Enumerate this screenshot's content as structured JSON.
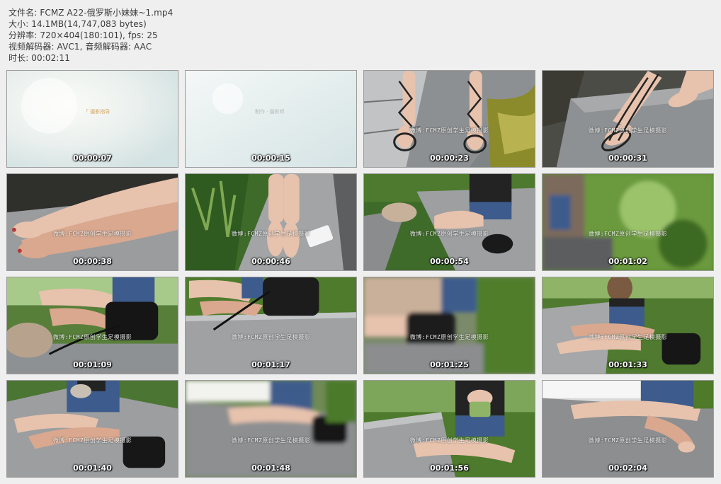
{
  "header": {
    "filename": "文件名: FCMZ A22-俄罗斯小妹妹~1.mp4",
    "size": "大小: 14.1MB(14,747,083 bytes)",
    "resolution": "分辨率: 720×404(180:101), fps: 25",
    "codecs": "视频解码器: AVC1, 音频解码器: AAC",
    "duration": "时长: 00:02:11"
  },
  "thumbnails": [
    {
      "time": "00:00:07",
      "scene": "intro-1",
      "caption": "「 摄影指导",
      "watermark": ""
    },
    {
      "time": "00:00:15",
      "scene": "intro-2",
      "caption": "制作 · 摄影师",
      "watermark": ""
    },
    {
      "time": "00:00:23",
      "scene": "feet-pond",
      "caption": "",
      "watermark": "微博:FCMZ原创学生足模摄影"
    },
    {
      "time": "00:00:31",
      "scene": "feet-stone",
      "caption": "",
      "watermark": "微博:FCMZ原创学生足模摄影"
    },
    {
      "time": "00:00:38",
      "scene": "soles-close",
      "caption": "",
      "watermark": "微博:FCMZ原创学生足模摄影"
    },
    {
      "time": "00:00:46",
      "scene": "feet-phone",
      "caption": "",
      "watermark": "微博:FCMZ原创学生足模摄影"
    },
    {
      "time": "00:00:54",
      "scene": "sitting-wall",
      "caption": "",
      "watermark": "微博:FCMZ原创学生足模摄影"
    },
    {
      "time": "00:01:02",
      "scene": "blur-green",
      "caption": "",
      "watermark": "微博:FCMZ原创学生足模摄影"
    },
    {
      "time": "00:01:09",
      "scene": "legs-bag",
      "caption": "",
      "watermark": "微博:FCMZ原创学生足模摄影"
    },
    {
      "time": "00:01:17",
      "scene": "bag-wall",
      "caption": "",
      "watermark": "微博:FCMZ原创学生足模摄影"
    },
    {
      "time": "00:01:25",
      "scene": "blur-bag",
      "caption": "",
      "watermark": "微博:FCMZ原创学生足模摄影"
    },
    {
      "time": "00:01:33",
      "scene": "sitting-face",
      "caption": "",
      "watermark": "微博:FCMZ原创学生足模摄影"
    },
    {
      "time": "00:01:40",
      "scene": "sitting-blue",
      "caption": "",
      "watermark": "微博:FCMZ原创学生足模摄影"
    },
    {
      "time": "00:01:48",
      "scene": "blur-wall",
      "caption": "",
      "watermark": "微博:FCMZ原创学生足模摄影"
    },
    {
      "time": "00:01:56",
      "scene": "sitting-black",
      "caption": "",
      "watermark": "微博:FCMZ原创学生足模摄影"
    },
    {
      "time": "00:02:04",
      "scene": "legs-wall",
      "caption": "",
      "watermark": "微博:FCMZ原创学生足模摄影"
    }
  ]
}
